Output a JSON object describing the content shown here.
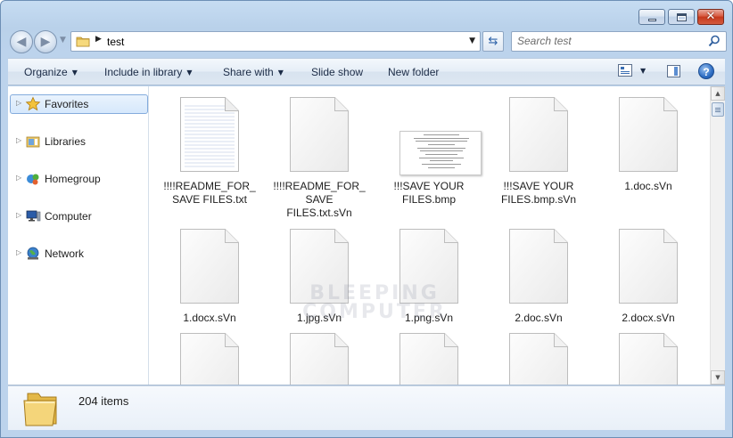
{
  "window": {
    "caption_buttons": [
      "minimize",
      "maximize",
      "close"
    ],
    "close_glyph": "✕"
  },
  "address_bar": {
    "breadcrumb": "test",
    "search_placeholder": "Search test"
  },
  "toolbar": {
    "organize": "Organize",
    "include_in_library": "Include in library",
    "share_with": "Share with",
    "slide_show": "Slide show",
    "new_folder": "New folder",
    "help": "?"
  },
  "navigation": [
    {
      "label": "Favorites",
      "icon": "star-icon",
      "selected": true
    },
    {
      "label": "Libraries",
      "icon": "libraries-icon",
      "selected": false
    },
    {
      "label": "Homegroup",
      "icon": "homegroup-icon",
      "selected": false
    },
    {
      "label": "Computer",
      "icon": "computer-icon",
      "selected": false
    },
    {
      "label": "Network",
      "icon": "network-icon",
      "selected": false
    }
  ],
  "files": [
    {
      "name": "!!!!README_FOR_\nSAVE FILES.txt",
      "kind": "txt"
    },
    {
      "name": "!!!!README_FOR_\nSAVE\nFILES.txt.sVn",
      "kind": "blank"
    },
    {
      "name": "!!!SAVE YOUR\nFILES.bmp",
      "kind": "bmp"
    },
    {
      "name": "!!!SAVE YOUR\nFILES.bmp.sVn",
      "kind": "blank"
    },
    {
      "name": "1.doc.sVn",
      "kind": "blank"
    },
    {
      "name": "1.docx.sVn",
      "kind": "blank"
    },
    {
      "name": "1.jpg.sVn",
      "kind": "blank"
    },
    {
      "name": "1.png.sVn",
      "kind": "blank"
    },
    {
      "name": "2.doc.sVn",
      "kind": "blank"
    },
    {
      "name": "2.docx.sVn",
      "kind": "blank"
    },
    {
      "name": "",
      "kind": "blank"
    },
    {
      "name": "",
      "kind": "blank"
    },
    {
      "name": "",
      "kind": "blank"
    },
    {
      "name": "",
      "kind": "blank"
    },
    {
      "name": "",
      "kind": "blank"
    }
  ],
  "watermark": "BLEEPING\nCOMPUTER",
  "details": {
    "item_count": "204 items"
  }
}
